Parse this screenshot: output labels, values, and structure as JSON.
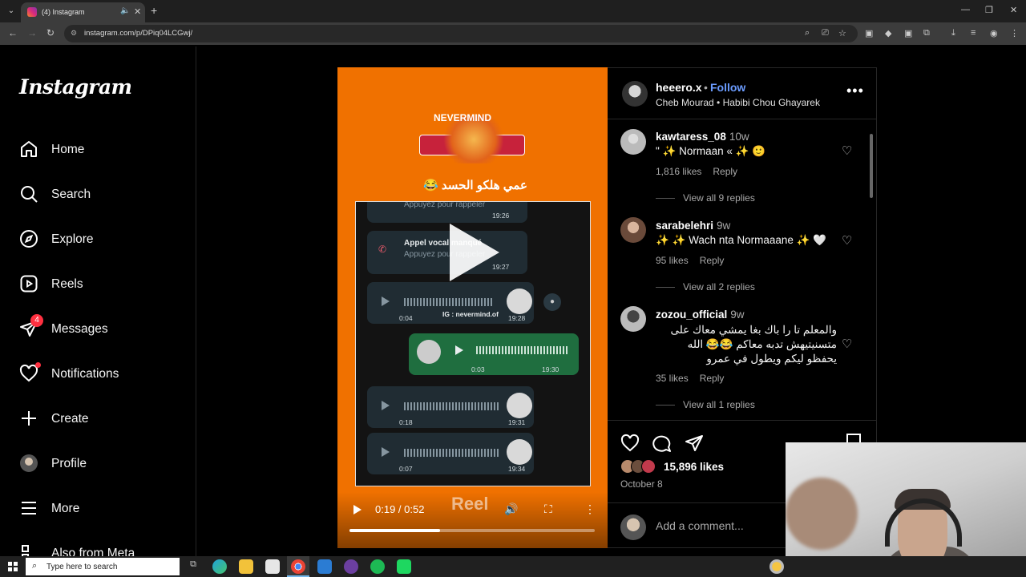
{
  "browser": {
    "tab_title": "(4) Instagram",
    "url": "instagram.com/p/DPiq04LCGwj/",
    "new_tab": "+",
    "close_tab": "✕"
  },
  "sidebar": {
    "logo": "Instagram",
    "items": [
      {
        "label": "Home",
        "icon": "home-icon"
      },
      {
        "label": "Search",
        "icon": "search-icon"
      },
      {
        "label": "Explore",
        "icon": "compass-icon"
      },
      {
        "label": "Reels",
        "icon": "reels-icon"
      },
      {
        "label": "Messages",
        "icon": "messenger-icon",
        "badge": "4"
      },
      {
        "label": "Notifications",
        "icon": "heart-icon"
      },
      {
        "label": "Create",
        "icon": "plus-icon"
      },
      {
        "label": "Profile",
        "icon": "avatar-icon"
      },
      {
        "label": "More",
        "icon": "menu-icon"
      },
      {
        "label": "Also from Meta",
        "icon": "meta-icon"
      }
    ]
  },
  "media": {
    "title_text": "NEVERMIND",
    "arabic_caption": "عمي هلكو الحسد 😂",
    "chat": {
      "call_sub_top": "Appuyez pour rappeler",
      "time_top": "19:26",
      "call_title": "Appel vocal manqué",
      "call_sub": "Appuyez pour rappeler",
      "call_time": "19:27",
      "voice_notes": [
        {
          "duration": "0:04",
          "time": "19:28"
        },
        {
          "duration": "0:03",
          "time": "19:30"
        },
        {
          "duration": "0:18",
          "time": "19:31"
        },
        {
          "duration": "0:07",
          "time": "19:34"
        }
      ],
      "watermark": "IG : nevermind.of"
    },
    "controls": {
      "time": "0:19 / 0:52",
      "reel_label": "Reel",
      "progress": 0.37
    }
  },
  "post": {
    "username": "heeero.x",
    "separator": "•",
    "follow": "Follow",
    "song": "Cheb Mourad • Habibi Chou Ghayarek",
    "more": "•••",
    "comments": [
      {
        "user": "kawtaress_08",
        "age": "10w",
        "text": "\" ✨ Normaan « ✨ 🙂",
        "likes": "1,816 likes",
        "reply": "Reply",
        "replies": "View all 9 replies"
      },
      {
        "user": "sarabelehri",
        "age": "9w",
        "text": "✨ ✨ Wach nta Normaaane ✨ 🤍",
        "likes": "95 likes",
        "reply": "Reply",
        "replies": "View all 2 replies"
      },
      {
        "user": "zozou_official",
        "age": "9w",
        "text": "والمعلم تا را باك بغا يمشي معاك على متسنيتيهش تدبه معاكم 😂😂 الله يحفظو ليكم ويطول في عمرو",
        "likes": "35 likes",
        "reply": "Reply",
        "replies": "View all 1 replies"
      }
    ],
    "likes_count": "15,896 likes",
    "date": "October 8",
    "add_comment_placeholder": "Add a comment..."
  },
  "taskbar": {
    "search_placeholder": "Type here to search"
  },
  "colors": {
    "media_bg": "#f07100",
    "follow_blue": "#6b9cff",
    "badge_red": "#ff3040"
  }
}
